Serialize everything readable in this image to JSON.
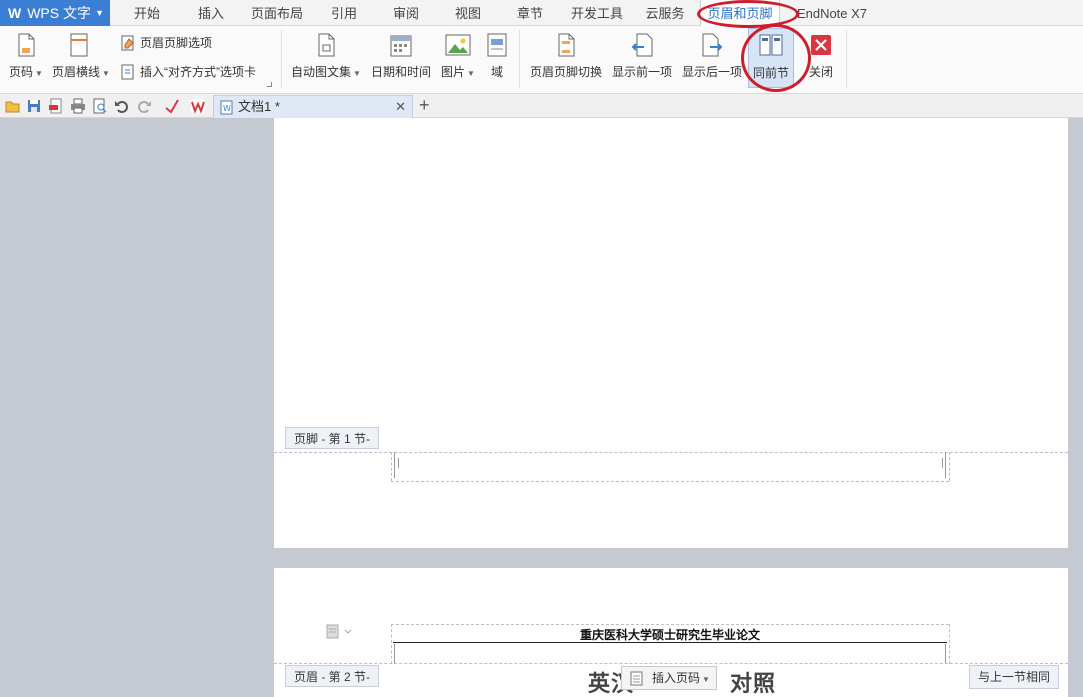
{
  "app": {
    "name": "WPS 文字"
  },
  "menu": {
    "tabs": [
      "开始",
      "插入",
      "页面布局",
      "引用",
      "审阅",
      "视图",
      "章节",
      "开发工具",
      "云服务",
      "页眉和页脚",
      "EndNote X7"
    ]
  },
  "ribbon": {
    "page_number": "页码",
    "header_line": "页眉横线",
    "header_footer_options": "页眉页脚选项",
    "insert_align_tab": "插入“对齐方式”选项卡",
    "auto_graphic_text": "自动图文集",
    "date_time": "日期和时间",
    "picture": "图片",
    "field": "域",
    "header_footer_switch": "页眉页脚切换",
    "show_previous": "显示前一项",
    "show_next": "显示后一项",
    "same_as_previous": "同前节",
    "close": "关闭"
  },
  "document": {
    "tab_title": "文档1 *"
  },
  "page1": {
    "footer_label": "页脚  - 第 1 节-"
  },
  "page2": {
    "header_label": "页眉  - 第 2 节-",
    "header_text": "重庆医科大学硕士研究生毕业论文",
    "body_text": "英汉",
    "body_text_tail": "对照",
    "insert_page_number": "插入页码",
    "same_as_previous_section": "与上一节相同"
  },
  "colors": {
    "accent": "#3b7fd4",
    "annotation": "#cc1f2b",
    "workspace": "#c5c9d1"
  }
}
